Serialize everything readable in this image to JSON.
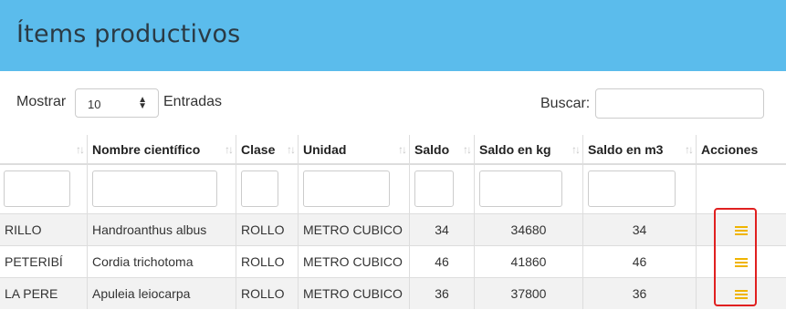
{
  "header": {
    "title": "Ítems productivos"
  },
  "controls": {
    "show_label": "Mostrar",
    "page_size": "10",
    "entries_label": "Entradas",
    "search_label": "Buscar:",
    "search_value": ""
  },
  "table": {
    "columns": [
      "",
      "Nombre científico",
      "Clase",
      "Unidad",
      "Saldo",
      "Saldo en kg",
      "Saldo en m3",
      "Acciones"
    ],
    "rows": [
      {
        "nombre": "RILLO",
        "cientifico": "Handroanthus albus",
        "clase": "ROLLO",
        "unidad": "METRO CUBICO",
        "saldo": "34",
        "kg": "34680",
        "m3": "34"
      },
      {
        "nombre": "PETERIBÍ",
        "cientifico": "Cordia trichotoma",
        "clase": "ROLLO",
        "unidad": "METRO CUBICO",
        "saldo": "46",
        "kg": "41860",
        "m3": "46"
      },
      {
        "nombre": "LA PERE",
        "cientifico": "Apuleia leiocarpa",
        "clase": "ROLLO",
        "unidad": "METRO CUBICO",
        "saldo": "36",
        "kg": "37800",
        "m3": "36"
      }
    ]
  },
  "colors": {
    "header_bg": "#5bbcec",
    "action_icon": "#f0b400",
    "highlight": "#e02020"
  },
  "icons": {
    "sort": "sort-icon",
    "action": "menu-icon",
    "select_arrow": "updown-arrow-icon"
  }
}
